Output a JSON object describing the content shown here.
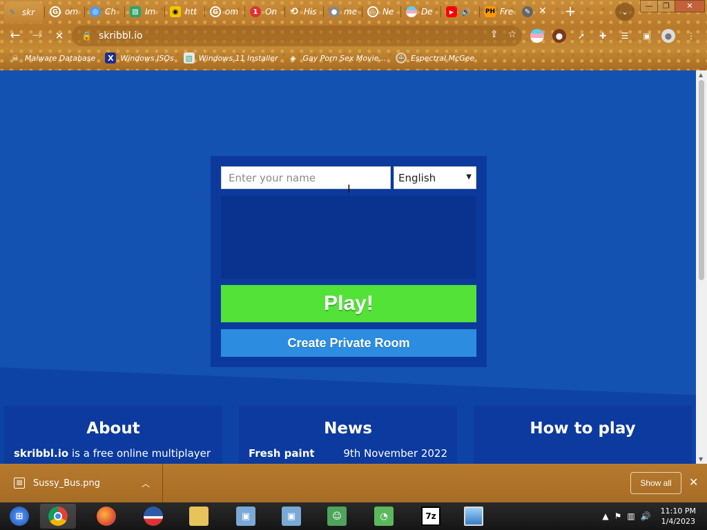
{
  "tabs": [
    {
      "label": "skr",
      "icon": "quill-icon",
      "color": "#3b7bdb"
    },
    {
      "label": "om",
      "icon": "google-icon",
      "color": "#ffffff"
    },
    {
      "label": "Ch",
      "icon": "chat-icon",
      "color": "#4f9be8"
    },
    {
      "label": "Im",
      "icon": "image-icon",
      "color": "#2fa36b"
    },
    {
      "label": "htt",
      "icon": "mask-icon",
      "color": "#f5c400"
    },
    {
      "label": "om",
      "icon": "google-icon",
      "color": "#ffffff"
    },
    {
      "label": "On",
      "icon": "badge-icon",
      "color": "#e03131"
    },
    {
      "label": "His",
      "icon": "history-icon",
      "color": "#ffffff"
    },
    {
      "label": "me",
      "icon": "globe-icon",
      "color": "#888888"
    },
    {
      "label": "Ne",
      "icon": "chrome-icon",
      "color": "#ffffff"
    },
    {
      "label": "De",
      "icon": "flag-icon",
      "color": "#f4a6c6"
    },
    {
      "label": "",
      "icon": "youtube-icon",
      "color": "#ff0000"
    },
    {
      "label": "Fre",
      "icon": "ph-icon",
      "color": "#ff9900"
    },
    {
      "label": "",
      "icon": "skribbl-icon",
      "color": "#666666"
    }
  ],
  "tab_strip": {
    "new_tab": "+",
    "tab_menu": "⌄",
    "close": "✕"
  },
  "window": {
    "minimize": "—",
    "restore": "❐",
    "close": "✕"
  },
  "toolbar": {
    "url": "skribbl.io"
  },
  "bookmarks": [
    {
      "label": "Malware Database",
      "icon": "skull-icon"
    },
    {
      "label": "Windows ISOs",
      "icon": "x-logo-icon"
    },
    {
      "label": "Windows 11 Installer",
      "icon": "image-icon"
    },
    {
      "label": "Gay Porn Sex Movie...",
      "icon": "disk-icon"
    },
    {
      "label": "Espectral McGee",
      "icon": "avatar-icon"
    }
  ],
  "game": {
    "name_placeholder": "Enter your name",
    "language": "English",
    "play_label": "Play!",
    "private_room_label": "Create Private Room"
  },
  "sections": {
    "about": {
      "title": "About",
      "text_bold": "skribbl.io",
      "text": " is a free online multiplayer"
    },
    "news": {
      "title": "News",
      "item": "Fresh paint",
      "date": "9th November 2022"
    },
    "howto": {
      "title": "How to play"
    }
  },
  "download": {
    "filename": "Sussy_Bus.png",
    "show_all": "Show all"
  },
  "clock": {
    "time": "11:10 PM",
    "date": "1/4/2023"
  }
}
